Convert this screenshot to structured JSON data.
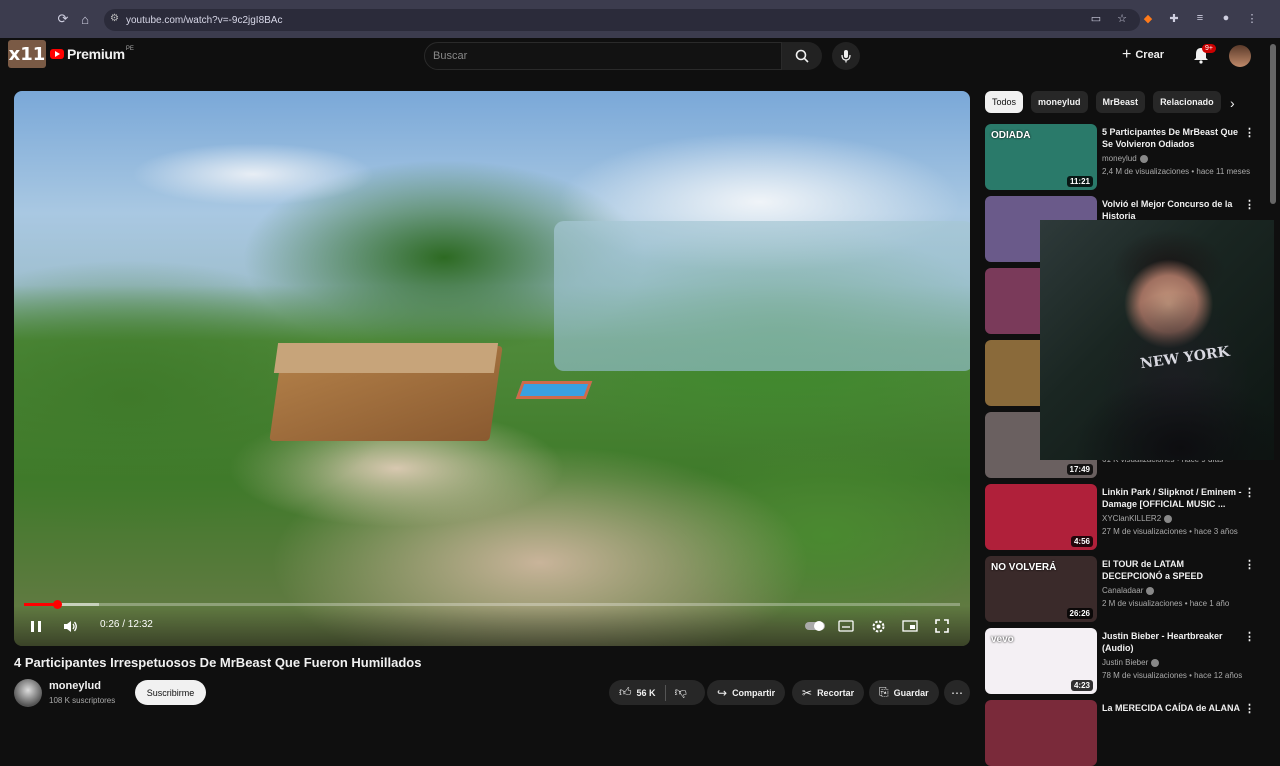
{
  "browser": {
    "url": "youtube.com/watch?v=-9c2jgI8BAc"
  },
  "header": {
    "logo_overlay": "x11",
    "logo_text": "Premium",
    "logo_region": "PE",
    "search_placeholder": "Buscar",
    "create_label": "Crear",
    "notifications_badge": "9+"
  },
  "player": {
    "time": "0:26 / 12:32",
    "progress_fraction": 0.035,
    "buffer_fraction": 0.08
  },
  "video": {
    "title": "4 Participantes Irrespetuosos De MrBeast Que Fueron Humillados",
    "channel": "moneylud",
    "subscribers": "108 K suscriptores",
    "subscribe_label": "Suscribirme",
    "likes": "56 K",
    "share_label": "Compartir",
    "clip_label": "Recortar",
    "save_label": "Guardar"
  },
  "chips": [
    "Todos",
    "moneylud",
    "MrBeast",
    "Relacionado"
  ],
  "recommendations": [
    {
      "title": "5 Participantes De MrBeast Que Se Volvieron Odiados",
      "channel": "moneylud",
      "meta": "2,4 M de visualizaciones • hace 11 meses",
      "duration": "11:21",
      "thumb_text": "ODIADA",
      "thumb_color": "#2a7a6a"
    },
    {
      "title": "Volvió el Mejor Concurso de la Historia",
      "channel": "",
      "meta": "",
      "duration": "",
      "thumb_text": "",
      "thumb_color": "#6a5a8a"
    },
    {
      "title": "",
      "channel": "",
      "meta": "",
      "duration": "",
      "thumb_text": "",
      "thumb_color": "#7a3a5a"
    },
    {
      "title": "",
      "channel": "",
      "meta": "",
      "duration": "",
      "thumb_text": "",
      "thumb_color": "#8a6a3a"
    },
    {
      "title": "",
      "channel": "",
      "meta": "61 K visualizaciones • hace 9 días",
      "duration": "17:49",
      "thumb_text": "",
      "thumb_color": "#6a6060"
    },
    {
      "title": "Linkin Park / Slipknot / Eminem - Damage [OFFICIAL MUSIC ...",
      "channel": "XYClanKILLER2",
      "meta": "27 M de visualizaciones • hace 3 años",
      "duration": "4:56",
      "thumb_text": "",
      "thumb_color": "#b0203a"
    },
    {
      "title": "El TOUR de LATAM DECEPCIONÓ a SPEED",
      "channel": "Canaladaar",
      "meta": "2 M de visualizaciones • hace 1 año",
      "duration": "26:26",
      "thumb_text": "NO VOLVERÁ",
      "thumb_color": "#3a2a2a"
    },
    {
      "title": "Justin Bieber - Heartbreaker (Audio)",
      "channel": "Justin Bieber",
      "meta": "78 M de visualizaciones • hace 12 años",
      "duration": "4:23",
      "thumb_text": "vevo",
      "thumb_color": "#f4f0f4"
    },
    {
      "title": "La MERECIDA CAÍDA de ALANA",
      "channel": "",
      "meta": "",
      "duration": "",
      "thumb_text": "",
      "thumb_color": "#7a2a3a"
    }
  ],
  "webcam_overlay_text": "NEW YORK"
}
